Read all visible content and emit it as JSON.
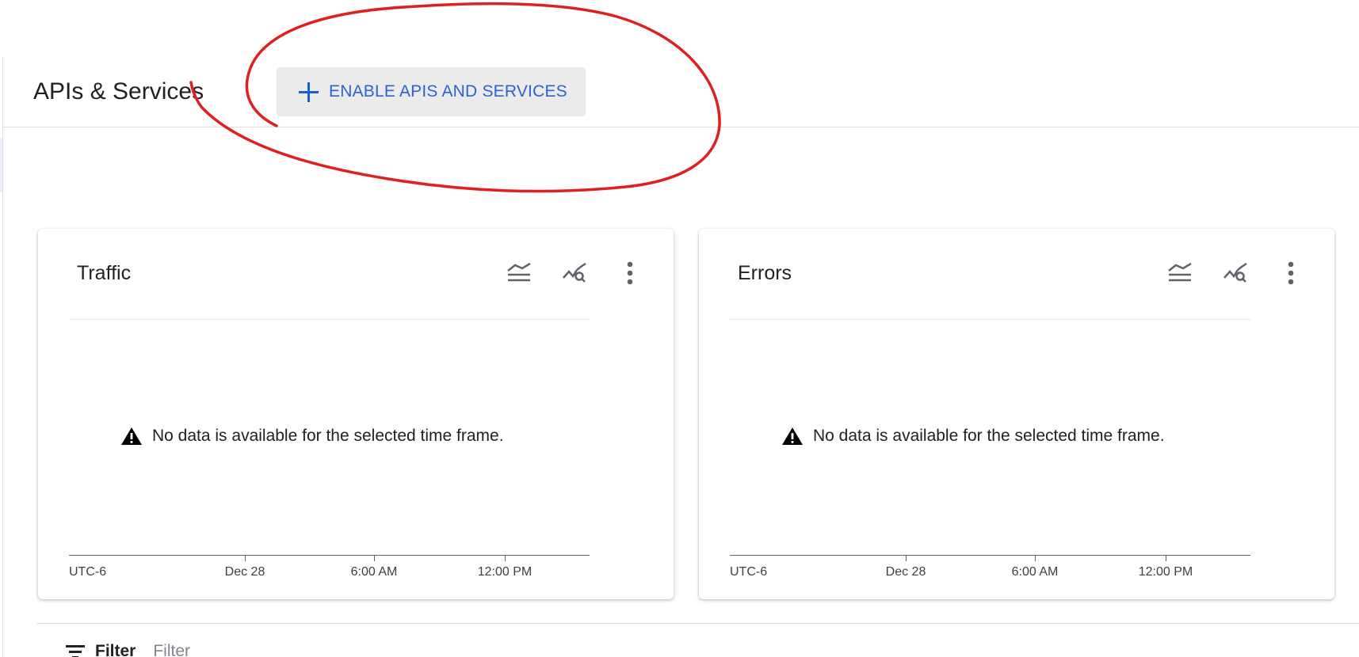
{
  "header": {
    "title": "APIs & Services",
    "enable_button_label": "ENABLE APIS AND SERVICES"
  },
  "cards": [
    {
      "title": "Traffic",
      "empty_message": "No data is available for the selected time frame.",
      "timezone": "UTC-6",
      "x_ticks": [
        "Dec 28",
        "6:00 AM",
        "12:00 PM"
      ]
    },
    {
      "title": "Errors",
      "empty_message": "No data is available for the selected time frame.",
      "timezone": "UTC-6",
      "x_ticks": [
        "Dec 28",
        "6:00 AM",
        "12:00 PM"
      ]
    }
  ],
  "filter": {
    "label": "Filter",
    "placeholder": "Filter"
  },
  "icons": {
    "add": "plus-icon",
    "legend": "legend-toggle-icon",
    "explore": "explore-metrics-icon",
    "more": "more-vert-icon",
    "warning": "warning-icon",
    "filter": "filter-list-icon"
  },
  "colors": {
    "accent": "#2a63d4",
    "button_bg": "#ebebeb",
    "annotation": "#e02020"
  }
}
